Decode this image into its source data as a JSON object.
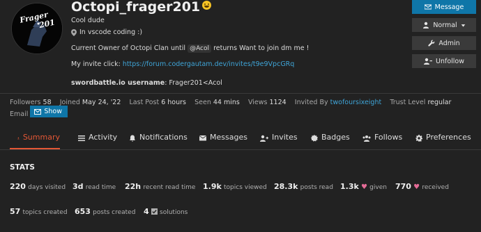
{
  "profile": {
    "username": "Octopi_frager201",
    "title": "Cool dude",
    "location": "In vscode coding :)",
    "bio_line1_pre": "Current Owner of Octopi Clan until",
    "bio_mention": "@Acol",
    "bio_line1_post": "returns Want to join dm me !",
    "invite_label": "My invite click:",
    "invite_link": "https://forum.codergautam.dev/invites/t9e9VpcGRq",
    "swordbattle_label": "swordbattle.io username",
    "swordbattle_value": ": Frager201<Acol",
    "avatar_text_line1": "Frager",
    "avatar_text_line2": "201"
  },
  "buttons": {
    "message": "Message",
    "normal": "Normal",
    "admin": "Admin",
    "unfollow": "Unfollow"
  },
  "meta": {
    "followers_label": "Followers",
    "followers_value": "58",
    "joined_label": "Joined",
    "joined_value": "May 24, '22",
    "last_post_label": "Last Post",
    "last_post_value": "6 hours",
    "seen_label": "Seen",
    "seen_value": "44 mins",
    "views_label": "Views",
    "views_value": "1124",
    "invited_label": "Invited By",
    "invited_value": "twofoursixeight",
    "trust_label": "Trust Level",
    "trust_value": "regular",
    "email_label": "Email",
    "show_label": "Show"
  },
  "tabs": {
    "summary": "Summary",
    "activity": "Activity",
    "notifications": "Notifications",
    "messages": "Messages",
    "invites": "Invites",
    "badges": "Badges",
    "follows": "Follows",
    "preferences": "Preferences"
  },
  "stats": {
    "heading": "STATS",
    "row1": [
      {
        "num": "220",
        "label": "days visited"
      },
      {
        "num": "3d",
        "label": "read time"
      },
      {
        "num": "22h",
        "label": "recent read time"
      },
      {
        "num": "1.9k",
        "label": "topics viewed"
      },
      {
        "num": "28.3k",
        "label": "posts read"
      },
      {
        "num": "1.3k",
        "label": "given"
      },
      {
        "num": "770",
        "label": "received"
      }
    ],
    "row2": [
      {
        "num": "57",
        "label": "topics created"
      },
      {
        "num": "653",
        "label": "posts created"
      },
      {
        "num": "4",
        "label": "solutions"
      }
    ]
  },
  "colors": {
    "background": "#222222",
    "accent": "#e45735",
    "link": "#3fa5d8",
    "primary_button": "#0f76a8"
  }
}
